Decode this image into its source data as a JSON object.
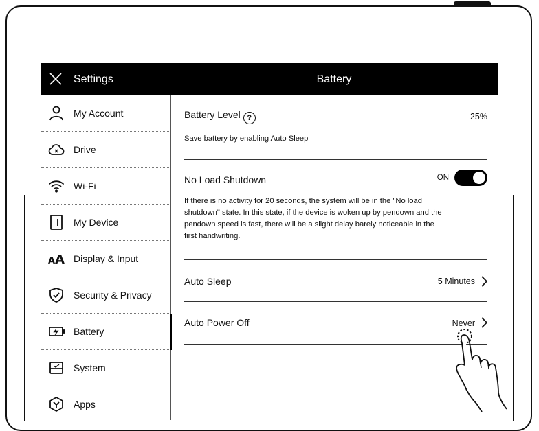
{
  "header": {
    "left_title": "Settings",
    "main_title": "Battery"
  },
  "sidebar": {
    "items": [
      {
        "label": "My Account",
        "icon": "person-icon"
      },
      {
        "label": "Drive",
        "icon": "cloud-icon"
      },
      {
        "label": "Wi-Fi",
        "icon": "wifi-icon"
      },
      {
        "label": "My Device",
        "icon": "device-icon"
      },
      {
        "label": "Display & Input",
        "icon": "font-size-icon"
      },
      {
        "label": "Security & Privacy",
        "icon": "shield-icon"
      },
      {
        "label": "Battery",
        "icon": "battery-icon"
      },
      {
        "label": "System",
        "icon": "system-icon"
      },
      {
        "label": "Apps",
        "icon": "apps-icon"
      }
    ],
    "active": "Battery"
  },
  "battery_level": {
    "label": "Battery Level",
    "help": "?",
    "value": "25%",
    "description": "Save battery by enabling Auto Sleep"
  },
  "no_load_shutdown": {
    "label": "No Load Shutdown",
    "state": "ON",
    "description": "If there is no activity for 20 seconds, the system will be in the \"No load shutdown\" state. In this state, if the device is woken up by pendown and the pendown speed is fast, there will be a slight delay barely noticeable in the first handwriting."
  },
  "auto_sleep": {
    "label": "Auto Sleep",
    "value": "5 Minutes"
  },
  "auto_power_off": {
    "label": "Auto Power Off",
    "value": "Never"
  }
}
